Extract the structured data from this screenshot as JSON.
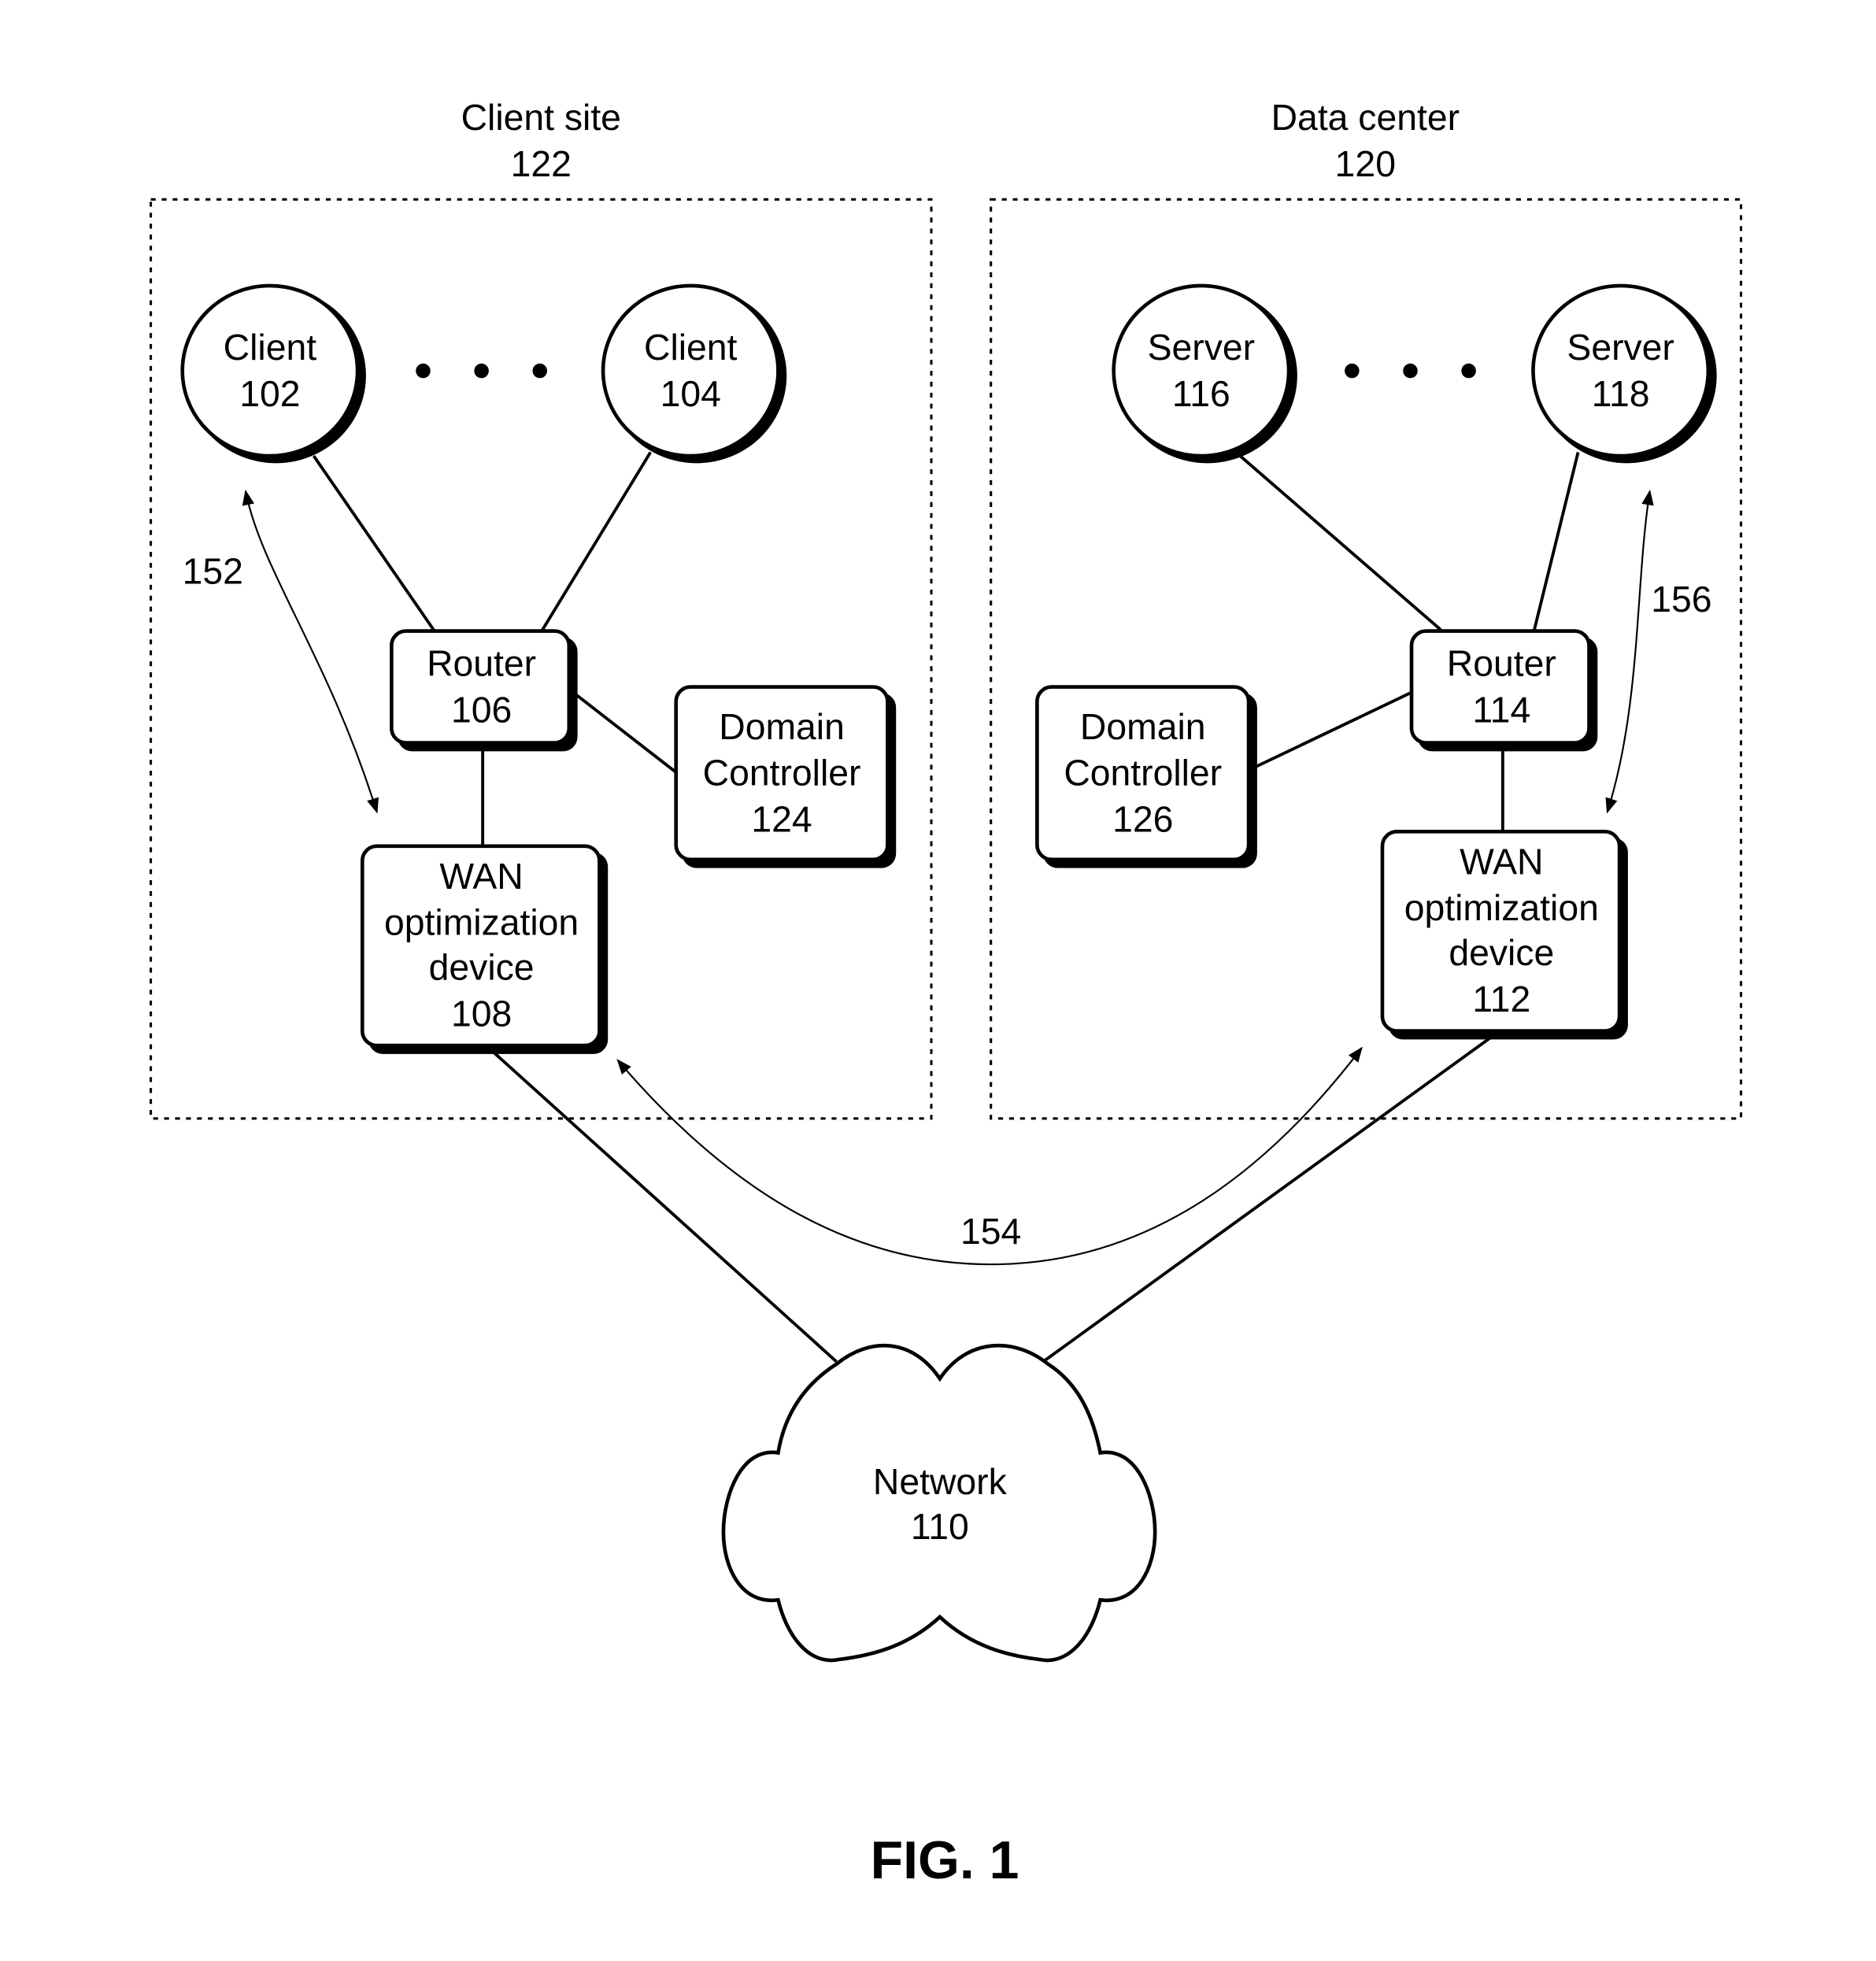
{
  "figure": {
    "caption": "FIG. 1"
  },
  "regions": {
    "client_site": {
      "title": "Client site",
      "ref": "122"
    },
    "data_center": {
      "title": "Data center",
      "ref": "120"
    }
  },
  "nodes": {
    "client_102": {
      "line1": "Client",
      "line2": "102"
    },
    "client_104": {
      "line1": "Client",
      "line2": "104"
    },
    "server_116": {
      "line1": "Server",
      "line2": "116"
    },
    "server_118": {
      "line1": "Server",
      "line2": "118"
    },
    "router_106": {
      "line1": "Router",
      "line2": "106"
    },
    "router_114": {
      "line1": "Router",
      "line2": "114"
    },
    "dc_124": {
      "line1": "Domain",
      "line2": "Controller",
      "line3": "124"
    },
    "dc_126": {
      "line1": "Domain",
      "line2": "Controller",
      "line3": "126"
    },
    "wan_108": {
      "line1": "WAN",
      "line2": "optimization",
      "line3": "device",
      "line4": "108"
    },
    "wan_112": {
      "line1": "WAN",
      "line2": "optimization",
      "line3": "device",
      "line4": "112"
    },
    "network_110": {
      "line1": "Network",
      "line2": "110"
    }
  },
  "connections": {
    "conn_152": {
      "label": "152"
    },
    "conn_154": {
      "label": "154"
    },
    "conn_156": {
      "label": "156"
    }
  }
}
